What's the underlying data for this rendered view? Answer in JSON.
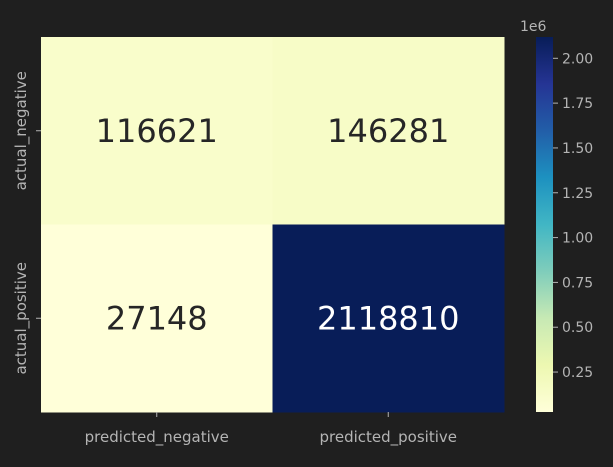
{
  "chart_data": {
    "type": "heatmap",
    "x_categories": [
      "predicted_negative",
      "predicted_positive"
    ],
    "y_categories": [
      "actual_negative",
      "actual_positive"
    ],
    "values": [
      [
        116621,
        146281
      ],
      [
        27148,
        2118810
      ]
    ],
    "cell_labels": [
      [
        "116621",
        "146281"
      ],
      [
        "27148",
        "2118810"
      ]
    ],
    "colormap": "YlGnBu",
    "colorbar": {
      "min": 27148,
      "max": 2118810,
      "ticks": [
        0.25,
        0.5,
        0.75,
        1.0,
        1.25,
        1.5,
        1.75,
        2.0
      ],
      "tick_labels": [
        "0.25",
        "0.50",
        "0.75",
        "1.00",
        "1.25",
        "1.50",
        "1.75",
        "2.00"
      ],
      "offset_label": "1e6",
      "tick_scale": 1000000
    },
    "colors": {
      "background": "#1f1f1f",
      "text": "#b4b4b4",
      "cell_text_dark": "#262626",
      "cell_text_light": "#ffffff"
    }
  }
}
